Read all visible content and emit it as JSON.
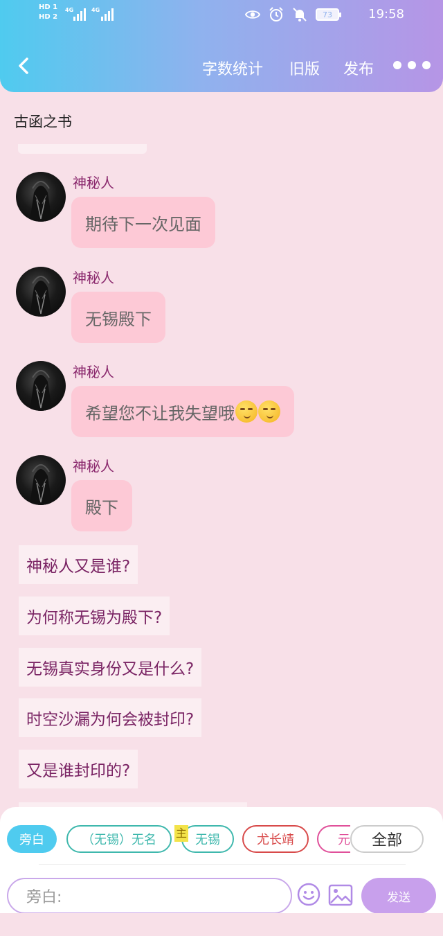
{
  "status_bar": {
    "sim1": "HD 1",
    "sim2": "HD 2",
    "net1": "4G",
    "net2": "4G",
    "battery": "73",
    "time": "19:58"
  },
  "header": {
    "word_count": "字数统计",
    "old_version": "旧版",
    "publish": "发布"
  },
  "book_title": "古函之书",
  "messages": [
    {
      "sender": "神秘人",
      "text": "期待下一次见面"
    },
    {
      "sender": "神秘人",
      "text": "无锡殿下"
    },
    {
      "sender": "神秘人",
      "text": "希望您不让我失望哦"
    },
    {
      "sender": "神秘人",
      "text": "殿下"
    }
  ],
  "narration": [
    "神秘人又是谁?",
    "为何称无锡为殿下?",
    "无锡真实身份又是什么?",
    "时空沙漏为何会被封印?",
    "又是谁封印的?"
  ],
  "tags": [
    {
      "label": "旁白",
      "style": "active"
    },
    {
      "label": "（无锡）无名",
      "style": "teal"
    },
    {
      "label": "无锡",
      "style": "teal",
      "marker": "主"
    },
    {
      "label": "尤长靖",
      "style": "red"
    },
    {
      "label": "元旦",
      "style": "pink"
    }
  ],
  "all_tag": "全部",
  "input": {
    "placeholder": "旁白:"
  },
  "send": "发送",
  "colors": {
    "header_start": "#4fcbef",
    "header_end": "#b695e6",
    "background": "#f8e0e8",
    "bubble": "#fdc9d6",
    "send": "#c8a0ec"
  }
}
